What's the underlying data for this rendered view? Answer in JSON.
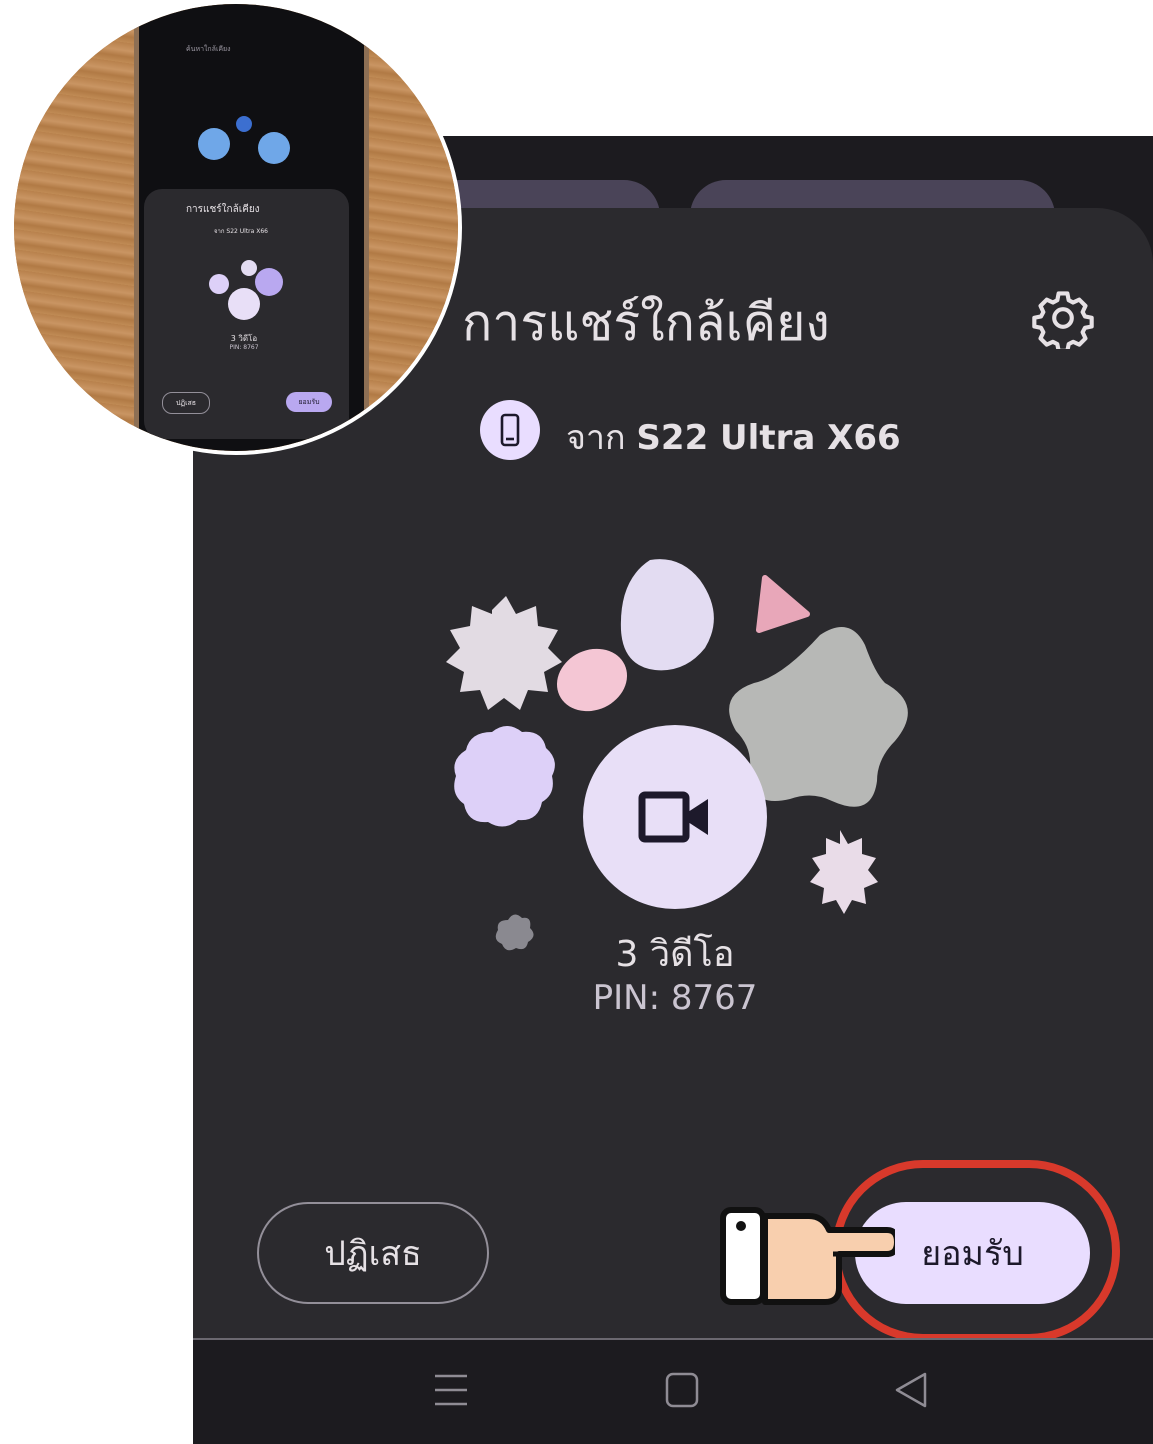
{
  "sheet": {
    "title": "การแชร์ใกล้เคียง",
    "from_prefix": "จาก",
    "device_name": "S22 Ultra X66",
    "item_count": "3 วิดีโอ",
    "pin": "PIN: 8767",
    "decline_label": "ปฏิเสธ",
    "accept_label": "ยอมรับ"
  },
  "icons": {
    "settings": "gear-icon",
    "device": "phone-icon",
    "content": "video-camera-icon",
    "pointer": "pointing-hand-icon"
  },
  "nav": {
    "recents": "menu-icon",
    "home": "home-icon",
    "back": "back-icon"
  },
  "inset": {
    "header": "ค้นหาใกล้เคียง",
    "title": "การแชร์ใกล้เคียง",
    "from": "จาก S22 Ultra X66",
    "count": "3 วิดีโอ",
    "pin": "PIN: 8767",
    "decline": "ปฏิเสธ",
    "accept": "ยอมรับ"
  },
  "colors": {
    "sheet_bg": "#2b2a2e",
    "accent": "#e9ddff",
    "highlight": "#d8392b"
  }
}
